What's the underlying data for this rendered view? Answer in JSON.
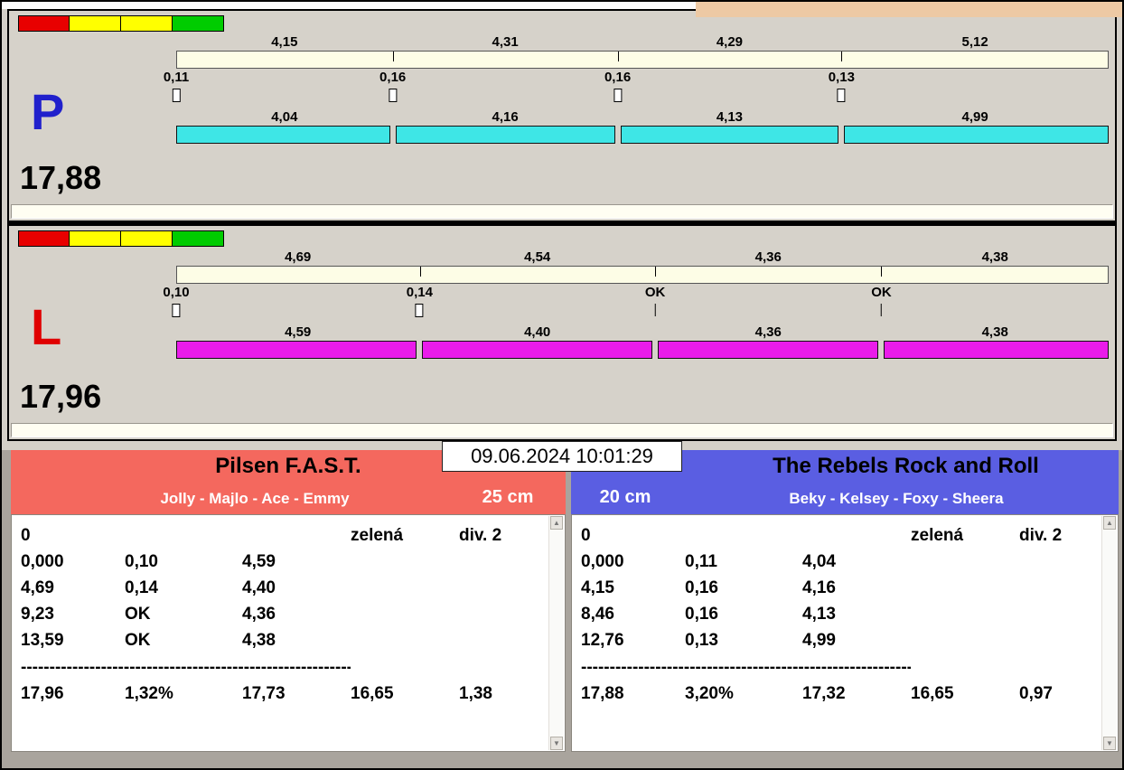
{
  "chrome": {
    "background_strip_color": "#edc9a4"
  },
  "icons": {
    "scroll_up": "▲",
    "scroll_down": "▼"
  },
  "datetime": "09.06.2024 10:01:29",
  "lanes": [
    {
      "id": "P",
      "letter": "P",
      "letter_color": "#2020cc",
      "bar_color": "#3ee6e6",
      "total": "17,88",
      "lights": [
        "#e80000",
        "#ffff00",
        "#ffff00",
        "#00cc00"
      ],
      "segments": [
        "4,15",
        "4,31",
        "4,29",
        "5,12"
      ],
      "changes": [
        {
          "label": "0,11",
          "marker": "box"
        },
        {
          "label": "0,16",
          "marker": "box"
        },
        {
          "label": "0,16",
          "marker": "box"
        },
        {
          "label": "0,13",
          "marker": "box"
        }
      ],
      "dog_times": [
        "4,04",
        "4,16",
        "4,13",
        "4,99"
      ]
    },
    {
      "id": "L",
      "letter": "L",
      "letter_color": "#e00000",
      "bar_color": "#ea1cea",
      "total": "17,96",
      "lights": [
        "#e80000",
        "#ffff00",
        "#ffff00",
        "#00cc00"
      ],
      "segments": [
        "4,69",
        "4,54",
        "4,36",
        "4,38"
      ],
      "changes": [
        {
          "label": "0,10",
          "marker": "box"
        },
        {
          "label": "0,14",
          "marker": "box"
        },
        {
          "label": "OK",
          "marker": "line"
        },
        {
          "label": "OK",
          "marker": "line"
        }
      ],
      "dog_times": [
        "4,59",
        "4,40",
        "4,36",
        "4,38"
      ]
    }
  ],
  "teams": [
    {
      "side": "left",
      "name": "Pilsen F.A.S.T.",
      "dogs": "Jolly - Majlo - Ace - Emmy",
      "jump_height": "25 cm",
      "header_color": "#f4685e",
      "table_rows": [
        [
          "0",
          "",
          "",
          "zelená",
          "div. 2"
        ],
        [
          "0,000",
          "0,10",
          "4,59",
          "",
          ""
        ],
        [
          "4,69",
          "0,14",
          "4,40",
          "",
          ""
        ],
        [
          "9,23",
          "OK",
          "4,36",
          "",
          ""
        ],
        [
          "13,59",
          "OK",
          "4,38",
          "",
          ""
        ],
        [
          "------------------------------------------------------------"
        ],
        [
          "17,96",
          "1,32%",
          "17,73",
          "16,65",
          "1,38"
        ]
      ]
    },
    {
      "side": "right",
      "name": "The Rebels Rock and Roll",
      "dogs": "Beky - Kelsey - Foxy - Sheera",
      "jump_height": "20 cm",
      "header_color": "#5a5ee2",
      "table_rows": [
        [
          "0",
          "",
          "",
          "zelená",
          "div. 2"
        ],
        [
          "0,000",
          "0,11",
          "4,04",
          "",
          ""
        ],
        [
          "4,15",
          "0,16",
          "4,16",
          "",
          ""
        ],
        [
          "8,46",
          "0,16",
          "4,13",
          "",
          ""
        ],
        [
          "12,76",
          "0,13",
          "4,99",
          "",
          ""
        ],
        [
          "------------------------------------------------------------"
        ],
        [
          "17,88",
          "3,20%",
          "17,32",
          "16,65",
          "0,97"
        ]
      ]
    }
  ]
}
